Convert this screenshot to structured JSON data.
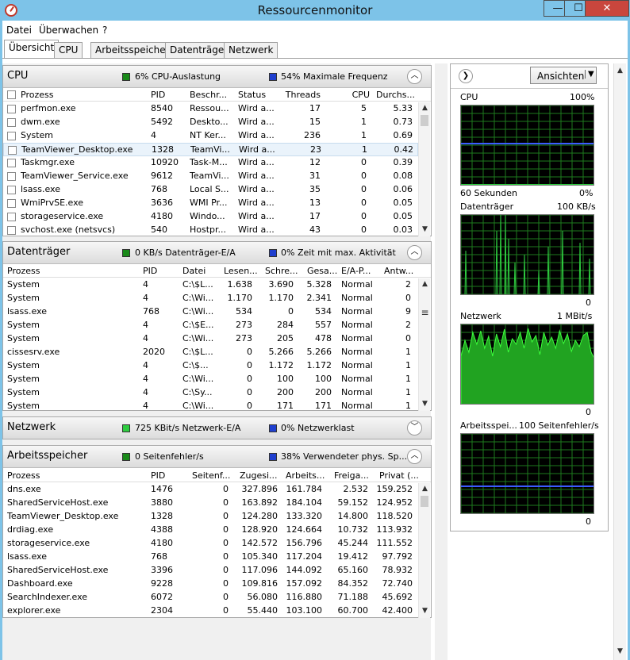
{
  "window": {
    "title": "Ressourcenmonitor",
    "min": "—",
    "max": "☐",
    "close": "✕"
  },
  "menu": [
    "Datei",
    "Überwachen",
    "?"
  ],
  "tabs": [
    "Übersicht",
    "CPU",
    "Arbeitsspeicher",
    "Datenträger",
    "Netzwerk"
  ],
  "cpu": {
    "title": "CPU",
    "info1": "6% CPU-Auslastung",
    "info2": "54% Maximale Frequenz",
    "c1": "#1a8a1a",
    "c2": "#1f3fcf",
    "headers": [
      "Prozess",
      "PID",
      "Beschr...",
      "Status",
      "Threads",
      "CPU",
      "Durchs..."
    ],
    "rows": [
      [
        "perfmon.exe",
        "8540",
        "Ressou...",
        "Wird a...",
        "17",
        "5",
        "5.33"
      ],
      [
        "dwm.exe",
        "5492",
        "Deskto...",
        "Wird a...",
        "15",
        "1",
        "0.73"
      ],
      [
        "System",
        "4",
        "NT Ker...",
        "Wird a...",
        "236",
        "1",
        "0.69"
      ],
      [
        "TeamViewer_Desktop.exe",
        "1328",
        "TeamVi...",
        "Wird a...",
        "23",
        "1",
        "0.42"
      ],
      [
        "Taskmgr.exe",
        "10920",
        "Task-M...",
        "Wird a...",
        "12",
        "0",
        "0.39"
      ],
      [
        "TeamViewer_Service.exe",
        "9612",
        "TeamVi...",
        "Wird a...",
        "31",
        "0",
        "0.08"
      ],
      [
        "lsass.exe",
        "768",
        "Local S...",
        "Wird a...",
        "35",
        "0",
        "0.06"
      ],
      [
        "WmiPrvSE.exe",
        "3636",
        "WMI Pr...",
        "Wird a...",
        "13",
        "0",
        "0.05"
      ],
      [
        "storageservice.exe",
        "4180",
        "Windo...",
        "Wird a...",
        "17",
        "0",
        "0.05"
      ],
      [
        "svchost.exe (netsvcs)",
        "540",
        "Hostpr...",
        "Wird a...",
        "43",
        "0",
        "0.03"
      ]
    ]
  },
  "disk": {
    "title": "Datenträger",
    "info1": "0 KB/s Datenträger-E/A",
    "info2": "0% Zeit mit max. Aktivität",
    "headers": [
      "Prozess",
      "PID",
      "Datei",
      "Lesen...",
      "Schre...",
      "Gesa...",
      "E/A-P...",
      "Antw..."
    ],
    "rows": [
      [
        "System",
        "4",
        "C:\\$L...",
        "1.638",
        "3.690",
        "5.328",
        "Normal",
        "2"
      ],
      [
        "System",
        "4",
        "C:\\Wi...",
        "1.170",
        "1.170",
        "2.341",
        "Normal",
        "0"
      ],
      [
        "lsass.exe",
        "768",
        "C:\\Wi...",
        "534",
        "0",
        "534",
        "Normal",
        "9"
      ],
      [
        "System",
        "4",
        "C:\\$E...",
        "273",
        "284",
        "557",
        "Normal",
        "2"
      ],
      [
        "System",
        "4",
        "C:\\Wi...",
        "273",
        "205",
        "478",
        "Normal",
        "0"
      ],
      [
        "cissesrv.exe",
        "2020",
        "C:\\$L...",
        "0",
        "5.266",
        "5.266",
        "Normal",
        "1"
      ],
      [
        "System",
        "4",
        "C:\\$...",
        "0",
        "1.172",
        "1.172",
        "Normal",
        "1"
      ],
      [
        "System",
        "4",
        "C:\\Wi...",
        "0",
        "100",
        "100",
        "Normal",
        "1"
      ],
      [
        "System",
        "4",
        "C:\\Sy...",
        "0",
        "200",
        "200",
        "Normal",
        "1"
      ],
      [
        "System",
        "4",
        "C:\\Wi...",
        "0",
        "171",
        "171",
        "Normal",
        "1"
      ]
    ]
  },
  "net": {
    "title": "Netzwerk",
    "info1": "725 KBit/s Netzwerk-E/A",
    "info2": "0% Netzwerklast"
  },
  "mem": {
    "title": "Arbeitsspeicher",
    "info1": "0 Seitenfehler/s",
    "info2": "38% Verwendeter phys. Sp...",
    "headers": [
      "Prozess",
      "PID",
      "Seitenf...",
      "Zugesi...",
      "Arbeits...",
      "Freiga...",
      "Privat (..."
    ],
    "rows": [
      [
        "dns.exe",
        "1476",
        "0",
        "327.896",
        "161.784",
        "2.532",
        "159.252"
      ],
      [
        "SharedServiceHost.exe",
        "3880",
        "0",
        "163.892",
        "184.104",
        "59.152",
        "124.952"
      ],
      [
        "TeamViewer_Desktop.exe",
        "1328",
        "0",
        "124.280",
        "133.320",
        "14.800",
        "118.520"
      ],
      [
        "drdiag.exe",
        "4388",
        "0",
        "128.920",
        "124.664",
        "10.732",
        "113.932"
      ],
      [
        "storageservice.exe",
        "4180",
        "0",
        "142.572",
        "156.796",
        "45.244",
        "111.552"
      ],
      [
        "lsass.exe",
        "768",
        "0",
        "105.340",
        "117.204",
        "19.412",
        "97.792"
      ],
      [
        "SharedServiceHost.exe",
        "3396",
        "0",
        "117.096",
        "144.092",
        "65.160",
        "78.932"
      ],
      [
        "Dashboard.exe",
        "9228",
        "0",
        "109.816",
        "157.092",
        "84.352",
        "72.740"
      ],
      [
        "SearchIndexer.exe",
        "6072",
        "0",
        "56.080",
        "116.880",
        "71.188",
        "45.692"
      ],
      [
        "explorer.exe",
        "2304",
        "0",
        "55.440",
        "103.100",
        "60.700",
        "42.400"
      ]
    ]
  },
  "graphs": {
    "views": "Ansichten",
    "cpu": {
      "label": "CPU",
      "max": "100%",
      "foot": "60 Sekunden",
      "min": "0%"
    },
    "disk": {
      "label": "Datenträger",
      "max": "100 KB/s",
      "min": "0"
    },
    "net": {
      "label": "Netzwerk",
      "max": "1 MBit/s",
      "min": "0"
    },
    "mem": {
      "label": "Arbeitsspei...",
      "max": "100 Seitenfehler/s",
      "min": "0"
    }
  }
}
